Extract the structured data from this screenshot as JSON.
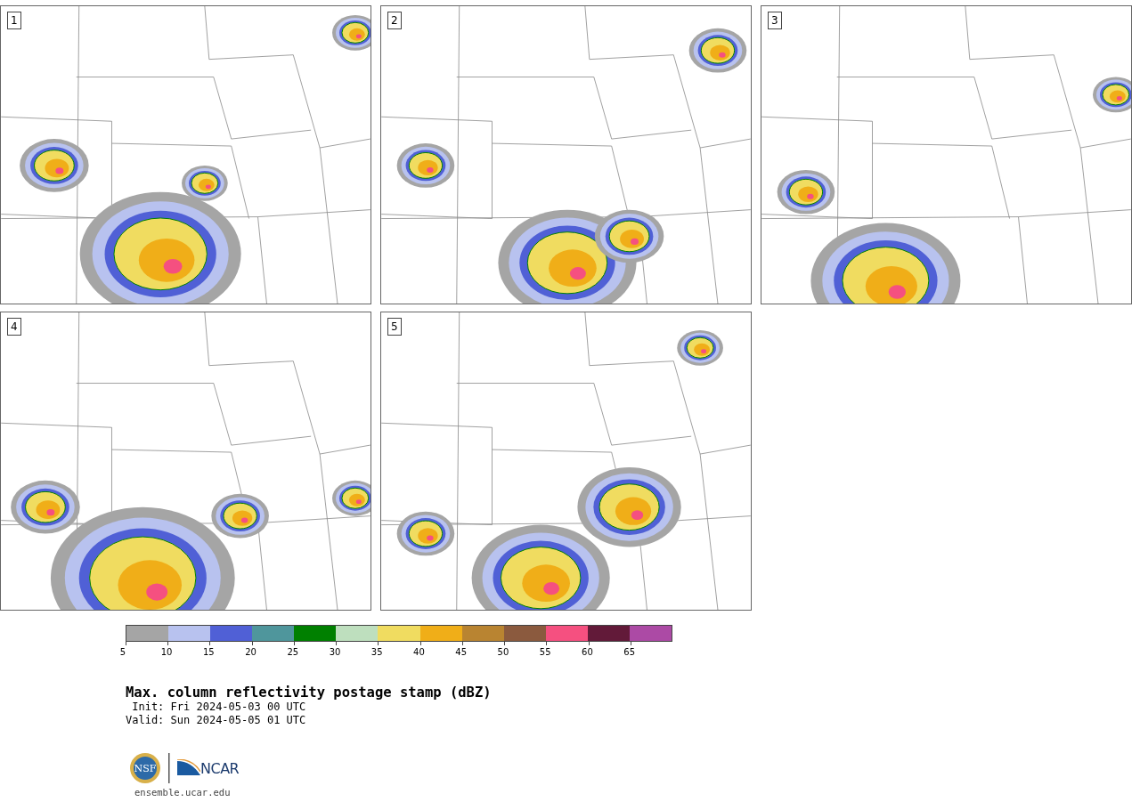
{
  "panels": [
    {
      "label": "1"
    },
    {
      "label": "2"
    },
    {
      "label": "3"
    },
    {
      "label": "4"
    },
    {
      "label": "5"
    }
  ],
  "colorbar": {
    "bins": [
      {
        "color": "#a5a5a5"
      },
      {
        "color": "#b8c2ef"
      },
      {
        "color": "#5060d6"
      },
      {
        "color": "#4f969c"
      },
      {
        "color": "#008000"
      },
      {
        "color": "#bedfbe"
      },
      {
        "color": "#f0dc60"
      },
      {
        "color": "#f0ae18"
      },
      {
        "color": "#b98431"
      },
      {
        "color": "#8b5a3e"
      },
      {
        "color": "#f55080"
      },
      {
        "color": "#621a39"
      },
      {
        "color": "#ac4aa5"
      }
    ],
    "ticks": [
      "5",
      "10",
      "15",
      "20",
      "25",
      "30",
      "35",
      "40",
      "45",
      "50",
      "55",
      "60",
      "65"
    ]
  },
  "title": "Max. column reflectivity postage stamp (dBZ)",
  "init": " Init: Fri 2024-05-03 00 UTC",
  "valid": "Valid: Sun 2024-05-05 01 UTC",
  "logo": {
    "left": "NSF",
    "right": "NCAR"
  },
  "url": "ensemble.ucar.edu"
}
